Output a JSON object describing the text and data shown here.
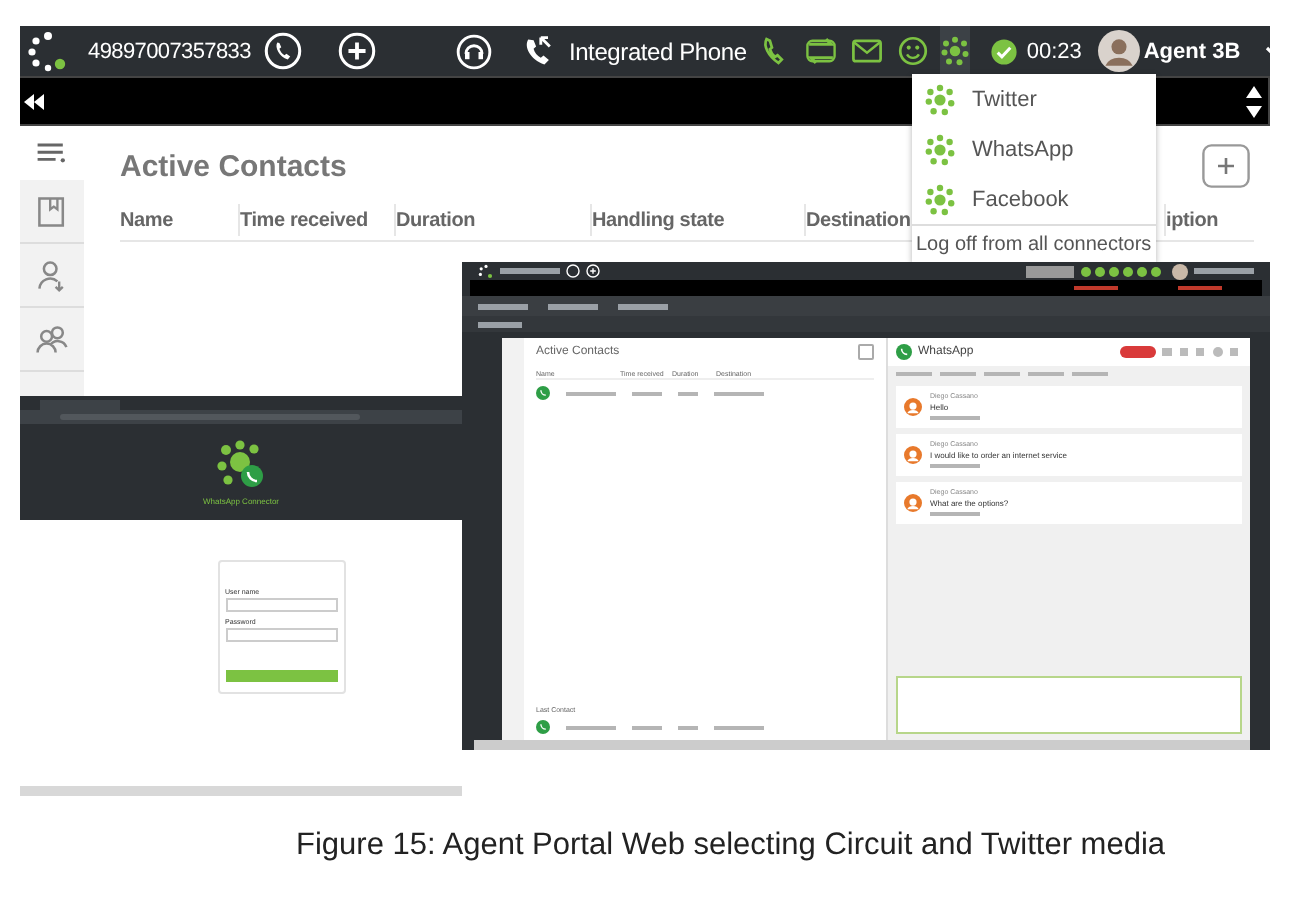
{
  "main_window": {
    "phone_number": "49897007357833",
    "phone_mode": "Integrated Phone",
    "timer": "00:23",
    "agent": "Agent 3B",
    "connectors_menu": {
      "items": [
        {
          "label": "Twitter"
        },
        {
          "label": "WhatsApp"
        },
        {
          "label": "Facebook"
        }
      ],
      "footer": "Log off from all connectors"
    },
    "panel_title": "Active Contacts",
    "columns": [
      "Name",
      "Time received",
      "Duration",
      "Handling state",
      "Destination",
      "iption"
    ]
  },
  "chat_window": {
    "panel_title": "Active Contacts",
    "columns": [
      "Name",
      "Time received",
      "Duration",
      "Destination"
    ],
    "chat_title": "WhatsApp",
    "messages": [
      {
        "sender": "Diego Cassano",
        "text": "Hello"
      },
      {
        "sender": "Diego Cassano",
        "text": "I would like to order an internet service"
      },
      {
        "sender": "Diego Cassano",
        "text": "What are the options?"
      }
    ],
    "last_contact_label": "Last Contact"
  },
  "login_window": {
    "app_name": "WhatsApp Connector",
    "fields": [
      {
        "label": "User name"
      },
      {
        "label": "Password"
      }
    ]
  },
  "caption": "Figure 15: Agent Portal Web selecting Circuit and Twitter media"
}
